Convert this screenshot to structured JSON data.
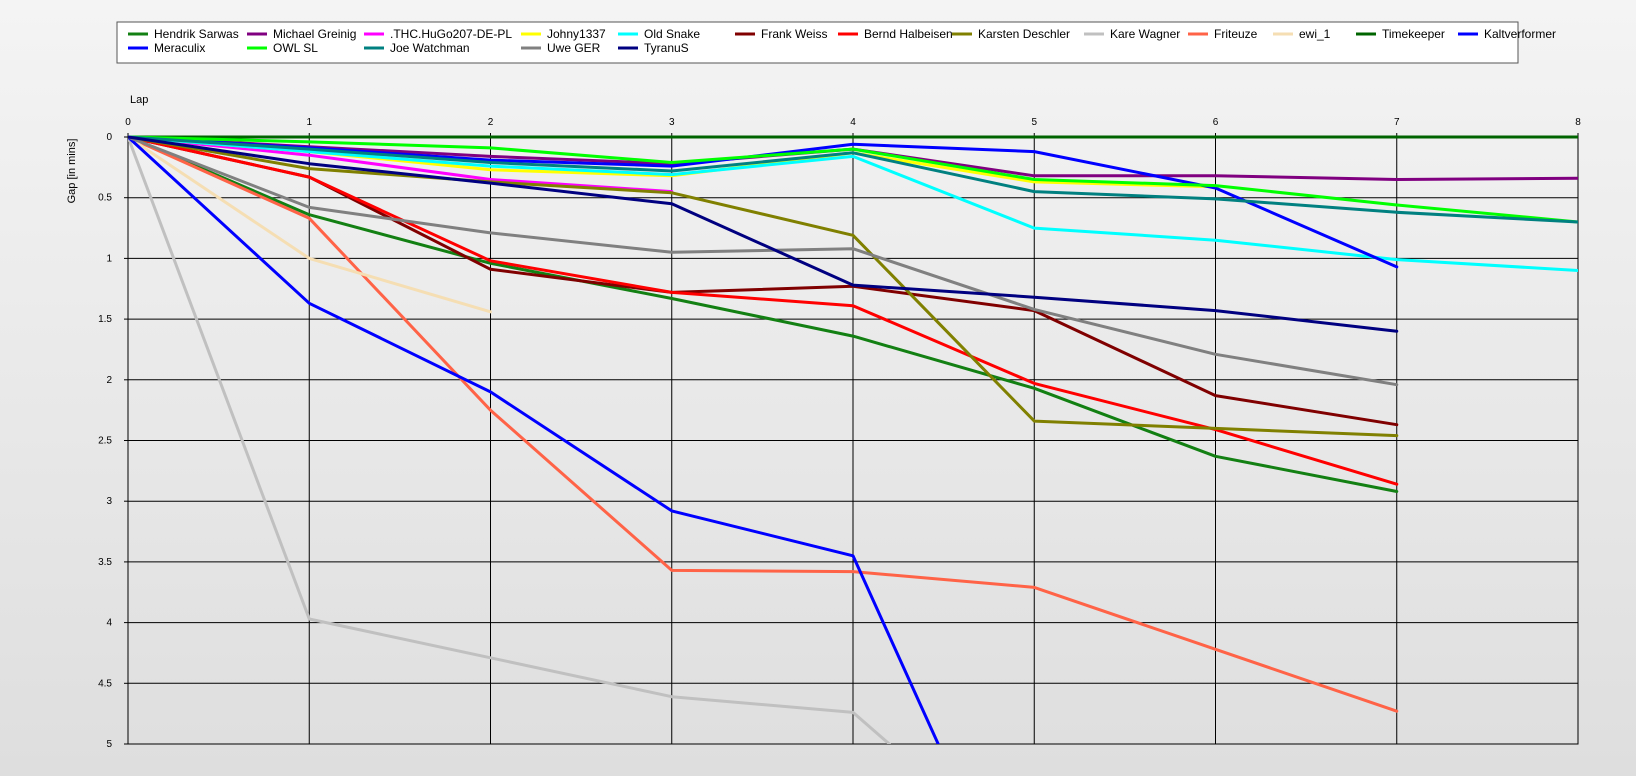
{
  "chart_data": {
    "type": "line",
    "xlabel": "Lap",
    "ylabel": "Gap [in mins]",
    "xlim": [
      0,
      8
    ],
    "ylim": [
      0,
      5
    ],
    "x_ticks": [
      "0",
      "1",
      "2",
      "3",
      "4",
      "5",
      "6",
      "7",
      "8"
    ],
    "y_ticks": [
      "0",
      "0.5",
      "1",
      "1.5",
      "2",
      "2.5",
      "3",
      "3.5",
      "4",
      "4.5",
      "5"
    ],
    "y_inverted": true,
    "grid": true,
    "legend_position": "top",
    "series": [
      {
        "name": "Hendrik Sarwas",
        "color": "#138013",
        "points": [
          [
            0,
            0
          ],
          [
            1,
            0.64
          ],
          [
            2,
            1.04
          ],
          [
            3,
            1.33
          ],
          [
            4,
            1.64
          ],
          [
            5,
            2.07
          ],
          [
            6,
            2.63
          ],
          [
            7,
            2.92
          ]
        ]
      },
      {
        "name": "Michael Greinig",
        "color": "#800080",
        "points": [
          [
            0,
            0
          ],
          [
            1,
            0.08
          ],
          [
            2,
            0.16
          ],
          [
            3,
            0.22
          ],
          [
            4,
            0.1
          ],
          [
            5,
            0.32
          ],
          [
            6,
            0.32
          ],
          [
            7,
            0.35
          ],
          [
            8,
            0.34
          ]
        ]
      },
      {
        "name": ".THC.HuGo207-DE-PL",
        "color": "#ff00ff",
        "points": [
          [
            0,
            0
          ],
          [
            1,
            0.15
          ],
          [
            2,
            0.35
          ],
          [
            3,
            0.45
          ]
        ]
      },
      {
        "name": "Johny1337",
        "color": "#ffff00",
        "points": [
          [
            0,
            0
          ],
          [
            1,
            0.12
          ],
          [
            2,
            0.27
          ],
          [
            3,
            0.32
          ],
          [
            4,
            0.13
          ],
          [
            5,
            0.37
          ],
          [
            6,
            0.41
          ]
        ]
      },
      {
        "name": "Old Snake",
        "color": "#00ffff",
        "points": [
          [
            0,
            0
          ],
          [
            1,
            0.12
          ],
          [
            2,
            0.24
          ],
          [
            3,
            0.31
          ],
          [
            4,
            0.16
          ],
          [
            5,
            0.75
          ],
          [
            6,
            0.85
          ],
          [
            7,
            1.01
          ],
          [
            8,
            1.1
          ]
        ]
      },
      {
        "name": "Frank Weiss",
        "color": "#800000",
        "points": [
          [
            0,
            0
          ],
          [
            1,
            0.33
          ],
          [
            2,
            1.09
          ],
          [
            3,
            1.28
          ],
          [
            4,
            1.23
          ],
          [
            5,
            1.43
          ],
          [
            6,
            2.13
          ],
          [
            7,
            2.37
          ]
        ]
      },
      {
        "name": "Bernd Halbeisen",
        "color": "#ff0000",
        "points": [
          [
            0,
            0
          ],
          [
            1,
            0.33
          ],
          [
            2,
            1.02
          ],
          [
            3,
            1.28
          ],
          [
            4,
            1.39
          ],
          [
            5,
            2.03
          ],
          [
            6,
            2.41
          ],
          [
            7,
            2.86
          ]
        ]
      },
      {
        "name": "Karsten Deschler",
        "color": "#808000",
        "points": [
          [
            0,
            0
          ],
          [
            1,
            0.26
          ],
          [
            2,
            0.37
          ],
          [
            3,
            0.46
          ],
          [
            4,
            0.81
          ],
          [
            5,
            2.34
          ],
          [
            6,
            2.4
          ],
          [
            7,
            2.46
          ]
        ]
      },
      {
        "name": "Kare Wagner",
        "color": "#c0c0c0",
        "points": [
          [
            0,
            0
          ],
          [
            1,
            3.97
          ],
          [
            2,
            4.29
          ],
          [
            3,
            4.61
          ],
          [
            4,
            4.74
          ],
          [
            4.2,
            5.0
          ]
        ]
      },
      {
        "name": "Friteuze",
        "color": "#ff6347",
        "points": [
          [
            0,
            0
          ],
          [
            1,
            0.67
          ],
          [
            2,
            2.25
          ],
          [
            3,
            3.57
          ],
          [
            4,
            3.58
          ],
          [
            5,
            3.71
          ],
          [
            6,
            4.22
          ],
          [
            7,
            4.73
          ]
        ]
      },
      {
        "name": "ewi_1",
        "color": "#f5deb3",
        "points": [
          [
            0,
            0
          ],
          [
            1,
            1.0
          ],
          [
            2,
            1.44
          ]
        ]
      },
      {
        "name": "Timekeeper",
        "color": "#006400",
        "points": [
          [
            0,
            0
          ],
          [
            1,
            0
          ],
          [
            2,
            0
          ],
          [
            3,
            0
          ],
          [
            4,
            0
          ],
          [
            5,
            0
          ],
          [
            6,
            0
          ],
          [
            7,
            0
          ],
          [
            8,
            0
          ]
        ]
      },
      {
        "name": "Kaltverformer",
        "color": "#0000ff",
        "points": [
          [
            0,
            0
          ],
          [
            1,
            0.09
          ],
          [
            2,
            0.19
          ],
          [
            3,
            0.24
          ],
          [
            4,
            0.06
          ],
          [
            5,
            0.12
          ],
          [
            6,
            0.42
          ],
          [
            7,
            1.07
          ]
        ]
      },
      {
        "name": "Meraculix",
        "color": "#0000ff",
        "points": [
          [
            0,
            0
          ],
          [
            1,
            1.37
          ],
          [
            2,
            2.1
          ],
          [
            3,
            3.08
          ],
          [
            4,
            3.45
          ],
          [
            4.47,
            5.0
          ]
        ]
      },
      {
        "name": "OWL SL",
        "color": "#00ff00",
        "points": [
          [
            0,
            0
          ],
          [
            1,
            0.04
          ],
          [
            2,
            0.09
          ],
          [
            3,
            0.21
          ],
          [
            4,
            0.1
          ],
          [
            5,
            0.35
          ],
          [
            6,
            0.4
          ],
          [
            7,
            0.56
          ],
          [
            8,
            0.7
          ]
        ]
      },
      {
        "name": "Joe Watchman",
        "color": "#008080",
        "points": [
          [
            0,
            0
          ],
          [
            1,
            0.1
          ],
          [
            2,
            0.21
          ],
          [
            3,
            0.28
          ],
          [
            4,
            0.13
          ],
          [
            5,
            0.45
          ],
          [
            6,
            0.51
          ],
          [
            7,
            0.62
          ],
          [
            8,
            0.7
          ]
        ]
      },
      {
        "name": "Uwe GER",
        "color": "#808080",
        "points": [
          [
            0,
            0
          ],
          [
            1,
            0.58
          ],
          [
            2,
            0.79
          ],
          [
            3,
            0.95
          ],
          [
            4,
            0.92
          ],
          [
            5,
            1.42
          ],
          [
            6,
            1.79
          ],
          [
            7,
            2.04
          ]
        ]
      },
      {
        "name": "TyranuS",
        "color": "#000080",
        "points": [
          [
            0,
            0
          ],
          [
            1,
            0.22
          ],
          [
            2,
            0.38
          ],
          [
            3,
            0.55
          ],
          [
            4,
            1.22
          ],
          [
            5,
            1.32
          ],
          [
            6,
            1.43
          ],
          [
            7,
            1.6
          ]
        ]
      }
    ]
  }
}
